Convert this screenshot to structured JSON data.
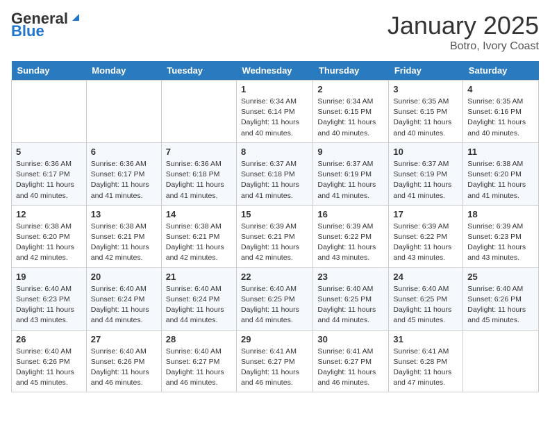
{
  "header": {
    "logo_general": "General",
    "logo_blue": "Blue",
    "month_title": "January 2025",
    "subtitle": "Botro, Ivory Coast"
  },
  "days_of_week": [
    "Sunday",
    "Monday",
    "Tuesday",
    "Wednesday",
    "Thursday",
    "Friday",
    "Saturday"
  ],
  "weeks": [
    [
      {
        "day": "",
        "info": ""
      },
      {
        "day": "",
        "info": ""
      },
      {
        "day": "",
        "info": ""
      },
      {
        "day": "1",
        "info": "Sunrise: 6:34 AM\nSunset: 6:14 PM\nDaylight: 11 hours and 40 minutes."
      },
      {
        "day": "2",
        "info": "Sunrise: 6:34 AM\nSunset: 6:15 PM\nDaylight: 11 hours and 40 minutes."
      },
      {
        "day": "3",
        "info": "Sunrise: 6:35 AM\nSunset: 6:15 PM\nDaylight: 11 hours and 40 minutes."
      },
      {
        "day": "4",
        "info": "Sunrise: 6:35 AM\nSunset: 6:16 PM\nDaylight: 11 hours and 40 minutes."
      }
    ],
    [
      {
        "day": "5",
        "info": "Sunrise: 6:36 AM\nSunset: 6:17 PM\nDaylight: 11 hours and 40 minutes."
      },
      {
        "day": "6",
        "info": "Sunrise: 6:36 AM\nSunset: 6:17 PM\nDaylight: 11 hours and 41 minutes."
      },
      {
        "day": "7",
        "info": "Sunrise: 6:36 AM\nSunset: 6:18 PM\nDaylight: 11 hours and 41 minutes."
      },
      {
        "day": "8",
        "info": "Sunrise: 6:37 AM\nSunset: 6:18 PM\nDaylight: 11 hours and 41 minutes."
      },
      {
        "day": "9",
        "info": "Sunrise: 6:37 AM\nSunset: 6:19 PM\nDaylight: 11 hours and 41 minutes."
      },
      {
        "day": "10",
        "info": "Sunrise: 6:37 AM\nSunset: 6:19 PM\nDaylight: 11 hours and 41 minutes."
      },
      {
        "day": "11",
        "info": "Sunrise: 6:38 AM\nSunset: 6:20 PM\nDaylight: 11 hours and 41 minutes."
      }
    ],
    [
      {
        "day": "12",
        "info": "Sunrise: 6:38 AM\nSunset: 6:20 PM\nDaylight: 11 hours and 42 minutes."
      },
      {
        "day": "13",
        "info": "Sunrise: 6:38 AM\nSunset: 6:21 PM\nDaylight: 11 hours and 42 minutes."
      },
      {
        "day": "14",
        "info": "Sunrise: 6:38 AM\nSunset: 6:21 PM\nDaylight: 11 hours and 42 minutes."
      },
      {
        "day": "15",
        "info": "Sunrise: 6:39 AM\nSunset: 6:21 PM\nDaylight: 11 hours and 42 minutes."
      },
      {
        "day": "16",
        "info": "Sunrise: 6:39 AM\nSunset: 6:22 PM\nDaylight: 11 hours and 43 minutes."
      },
      {
        "day": "17",
        "info": "Sunrise: 6:39 AM\nSunset: 6:22 PM\nDaylight: 11 hours and 43 minutes."
      },
      {
        "day": "18",
        "info": "Sunrise: 6:39 AM\nSunset: 6:23 PM\nDaylight: 11 hours and 43 minutes."
      }
    ],
    [
      {
        "day": "19",
        "info": "Sunrise: 6:40 AM\nSunset: 6:23 PM\nDaylight: 11 hours and 43 minutes."
      },
      {
        "day": "20",
        "info": "Sunrise: 6:40 AM\nSunset: 6:24 PM\nDaylight: 11 hours and 44 minutes."
      },
      {
        "day": "21",
        "info": "Sunrise: 6:40 AM\nSunset: 6:24 PM\nDaylight: 11 hours and 44 minutes."
      },
      {
        "day": "22",
        "info": "Sunrise: 6:40 AM\nSunset: 6:25 PM\nDaylight: 11 hours and 44 minutes."
      },
      {
        "day": "23",
        "info": "Sunrise: 6:40 AM\nSunset: 6:25 PM\nDaylight: 11 hours and 44 minutes."
      },
      {
        "day": "24",
        "info": "Sunrise: 6:40 AM\nSunset: 6:25 PM\nDaylight: 11 hours and 45 minutes."
      },
      {
        "day": "25",
        "info": "Sunrise: 6:40 AM\nSunset: 6:26 PM\nDaylight: 11 hours and 45 minutes."
      }
    ],
    [
      {
        "day": "26",
        "info": "Sunrise: 6:40 AM\nSunset: 6:26 PM\nDaylight: 11 hours and 45 minutes."
      },
      {
        "day": "27",
        "info": "Sunrise: 6:40 AM\nSunset: 6:26 PM\nDaylight: 11 hours and 46 minutes."
      },
      {
        "day": "28",
        "info": "Sunrise: 6:40 AM\nSunset: 6:27 PM\nDaylight: 11 hours and 46 minutes."
      },
      {
        "day": "29",
        "info": "Sunrise: 6:41 AM\nSunset: 6:27 PM\nDaylight: 11 hours and 46 minutes."
      },
      {
        "day": "30",
        "info": "Sunrise: 6:41 AM\nSunset: 6:27 PM\nDaylight: 11 hours and 46 minutes."
      },
      {
        "day": "31",
        "info": "Sunrise: 6:41 AM\nSunset: 6:28 PM\nDaylight: 11 hours and 47 minutes."
      },
      {
        "day": "",
        "info": ""
      }
    ]
  ]
}
